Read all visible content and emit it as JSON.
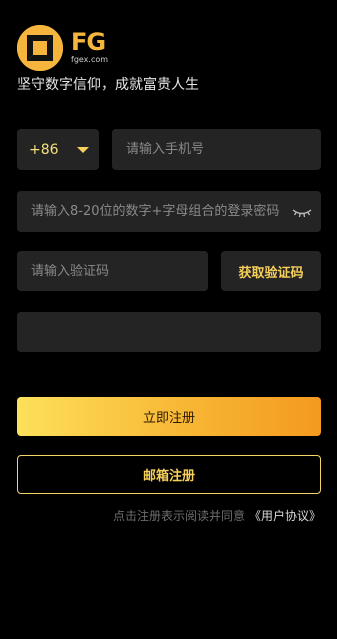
{
  "brand": {
    "logo_text": "FG",
    "logo_domain": "fgex.com",
    "slogan": "坚守数字信仰，成就富贵人生",
    "colors": {
      "gold": "#f6b53c",
      "gold_light": "#fde05a",
      "orange": "#f39a1f"
    }
  },
  "form": {
    "country_code": "+86",
    "phone_placeholder": "请输入手机号",
    "password_placeholder": "请输入8-20位的数字+字母组合的登录密码",
    "password_toggle_icon": "eye-closed-icon",
    "code_placeholder": "请输入验证码",
    "get_code_label": "获取验证码",
    "extra_value": ""
  },
  "actions": {
    "register_label": "立即注册",
    "email_register_label": "邮箱注册"
  },
  "agreement": {
    "text": "点击注册表示阅读并同意",
    "link_label": "《用户协议》"
  }
}
